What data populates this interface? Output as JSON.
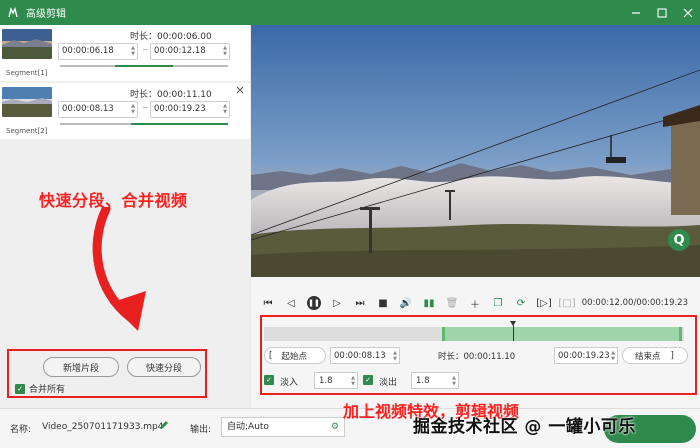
{
  "window": {
    "title": "高级剪辑",
    "minimize_icon": "minimize-icon",
    "maximize_icon": "maximize-icon",
    "close_icon": "close-icon"
  },
  "segments": [
    {
      "label": "Segment[1]",
      "duration_label": "时长：00:00:06.00",
      "start": "00:00:06.18",
      "end": "00:00:12.18",
      "progress_start": 0.33,
      "progress_end": 0.67
    },
    {
      "label": "Segment[2]",
      "duration_label": "时长：00:00:11.10",
      "start": "00:00:08.13",
      "end": "00:00:19.23",
      "progress_start": 0.42,
      "progress_end": 1.0
    }
  ],
  "range_separator": "~",
  "annotations": {
    "left": "快速分段、合并视频",
    "bottom": "加上视频特效，剪辑视频"
  },
  "actions": {
    "new_segment": "新增片段",
    "quick_split": "快速分段",
    "merge_all": "合并所有"
  },
  "player": {
    "timecode": "00:00:12.00/00:00:19.23"
  },
  "edit": {
    "start_point": "起始点",
    "start_time": "00:00:08.13",
    "duration": "时长：00:00:11.10",
    "end_time": "00:00:19.23",
    "end_point": "结束点",
    "fade_in_label": "淡入",
    "fade_in_value": "1.8",
    "fade_out_label": "淡出",
    "fade_out_value": "1.8"
  },
  "bottom": {
    "name_label": "名称:",
    "file_name": "Video_250701171933.mp4",
    "output_label": "输出:",
    "output_value": "自动;Auto"
  },
  "watermark": "掘金技术社区 @ 一罐小可乐",
  "colors": {
    "accent": "#2f8a4e",
    "annotation": "#ff2020"
  }
}
